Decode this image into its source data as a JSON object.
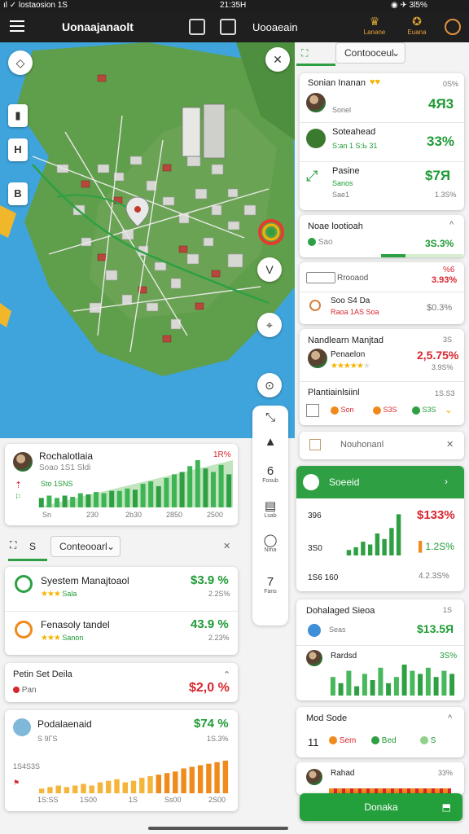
{
  "status": {
    "left": "ıl ✓ lostaosion 1S",
    "center": "21:35H",
    "right": "◉ ✈ 3l5%"
  },
  "topbar": {
    "title": "Uonaajanaolt",
    "title2": "Uooaeain",
    "brand1": "Lanane",
    "brand2": "Euana"
  },
  "map_controls": {
    "tool_h": "H",
    "tool_b": "B",
    "close": "✕",
    "filter": "V"
  },
  "vtool": [
    {
      "icon": "⤡",
      "label": ""
    },
    {
      "icon": "▲",
      "label": ""
    },
    {
      "icon": "6",
      "label": "Fosub"
    },
    {
      "icon": "▤",
      "label": "Lsab"
    },
    {
      "icon": "◯",
      "label": "Nma"
    },
    {
      "icon": "7",
      "label": "Fans"
    }
  ],
  "left_chart_card": {
    "title": "Rochalotlaia",
    "sub": "Soao 1S1 Sldi",
    "value": "1R%",
    "tag": "Sto 1SNS",
    "xticks": [
      "Sn",
      "230",
      "2b30",
      "2850",
      "2500"
    ]
  },
  "left_dropdown": {
    "tab": "S",
    "label": "Conteooarl",
    "close": "✕"
  },
  "left_list": [
    {
      "title": "Syestem Manajtoaol",
      "sub": "Sala",
      "value": "$3.9 %",
      "sub2": "2.2S%"
    },
    {
      "title": "Fenasoly tandel",
      "sub": "Sanon",
      "value": "43.9 %",
      "sub2": "2.23%"
    }
  ],
  "left_card3": {
    "title": "Petin Set Deila",
    "sub": "Pan",
    "value": "$2,0 %"
  },
  "left_card4": {
    "title": "Podalaenaid",
    "sub": "S 9ΓS",
    "value": "$74 %",
    "sub2": "1S.3%",
    "ylabel": "1S4S3S",
    "xticks": [
      "1S:SS",
      "1S00",
      "1S",
      "Ss00",
      "2S00"
    ]
  },
  "right_dropdown": {
    "label": "Contooceul"
  },
  "right_list": [
    {
      "title": "Sonian Inanan",
      "sub": "Sonel",
      "value": "4Я3",
      "top": "0S%"
    },
    {
      "title": "Soteahead",
      "sub": "S:an 1 S:Ь 31",
      "value": "33%",
      "top": ""
    },
    {
      "title": "Pasine",
      "sub": "Sae1",
      "value": "$7Я",
      "top": "",
      "sub2": "1.3S%",
      "tag": "Sanos"
    }
  ],
  "right_card2": {
    "title": "Noae lootioah",
    "sub": "Sao",
    "value": "3S.3%"
  },
  "right_card3": {
    "field": "Rrooaod",
    "value_top": "%6",
    "value": "3.93%",
    "row_title": "Soo S4 Da",
    "row_sub": "Raoa 1AS Soa",
    "row_value": "$0.3%"
  },
  "right_card4": {
    "title": "Nandlearn Manjtad",
    "top": "3S",
    "sub": "Penaelon",
    "value": "2,5.75%",
    "sub2": "3.9S%",
    "row_title": "Plantiainlsiinl",
    "row_top": "1S.S3",
    "legend": [
      "Son",
      "S3S",
      "S3S"
    ]
  },
  "right_card5": {
    "label": "Nouhonanl"
  },
  "green_card": {
    "header": "Soeeid",
    "v1": "396",
    "v2": "3S0",
    "v3": "1S6 160",
    "val1": "$133%",
    "val2": "1.2S%",
    "val3": "4.2.3S%"
  },
  "right_card6": {
    "title": "Dohalaged Sieoa",
    "top": "1S",
    "val": "$13.5Я",
    "sub": "Seas"
  },
  "right_card7": {
    "title": "Rardsd",
    "top": "3S%"
  },
  "right_card8": {
    "title": "Mod Sode",
    "sub1": "11",
    "l1": "Sem",
    "l2": "Bed",
    "l3": "S"
  },
  "right_card9": {
    "title": "Rahad",
    "top": "33%"
  },
  "cta": {
    "label": "Donaka"
  },
  "chart_data": [
    {
      "type": "bar",
      "categories": [
        "1",
        "2",
        "3",
        "4",
        "5",
        "6",
        "7",
        "8",
        "9",
        "10",
        "11",
        "12",
        "13",
        "14",
        "15",
        "16",
        "17",
        "18",
        "19",
        "20",
        "21",
        "22",
        "23",
        "24",
        "25"
      ],
      "values": [
        8,
        10,
        8,
        10,
        9,
        12,
        11,
        13,
        12,
        14,
        14,
        16,
        15,
        20,
        22,
        18,
        25,
        28,
        30,
        35,
        40,
        33,
        30,
        36,
        28
      ],
      "ylim": [
        0,
        40
      ]
    },
    {
      "type": "bar",
      "categories": [
        "1",
        "2",
        "3",
        "4",
        "5",
        "6",
        "7",
        "8",
        "9",
        "10",
        "11",
        "12",
        "13",
        "14",
        "15",
        "16",
        "17",
        "18",
        "19",
        "20",
        "21",
        "22",
        "23"
      ],
      "values": [
        3,
        4,
        5,
        4,
        5,
        6,
        5,
        7,
        8,
        9,
        7,
        8,
        10,
        11,
        12,
        13,
        14,
        16,
        17,
        18,
        19,
        20,
        21
      ],
      "ylim": [
        0,
        22
      ]
    },
    {
      "type": "bar",
      "categories": [
        "1",
        "2",
        "3",
        "4",
        "5",
        "6",
        "7",
        "8"
      ],
      "values": [
        2,
        3,
        5,
        4,
        8,
        6,
        10,
        15
      ],
      "ylim": [
        0,
        16
      ]
    },
    {
      "type": "bar",
      "categories": [
        "1",
        "2",
        "3",
        "4",
        "5",
        "6",
        "7",
        "8",
        "9",
        "10",
        "11",
        "12",
        "13",
        "14",
        "15",
        "16"
      ],
      "values": [
        6,
        4,
        8,
        3,
        7,
        5,
        9,
        4,
        6,
        10,
        8,
        7,
        9,
        6,
        8,
        7
      ],
      "ylim": [
        0,
        10
      ]
    }
  ]
}
